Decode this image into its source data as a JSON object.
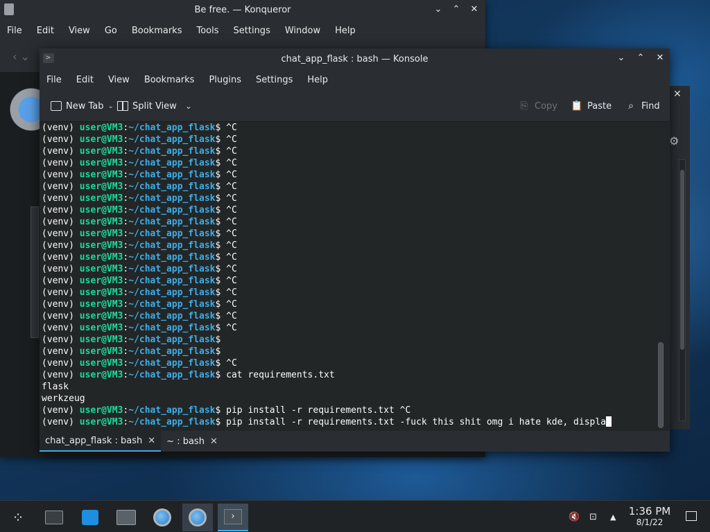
{
  "konqueror": {
    "title": "Be free. — Konqueror",
    "menu": [
      "File",
      "Edit",
      "View",
      "Go",
      "Bookmarks",
      "Tools",
      "Settings",
      "Window",
      "Help"
    ]
  },
  "konsole": {
    "title": "chat_app_flask : bash — Konsole",
    "menu": [
      "File",
      "Edit",
      "View",
      "Bookmarks",
      "Plugins",
      "Settings",
      "Help"
    ],
    "toolbar": {
      "new_tab": "New Tab",
      "split_view": "Split View",
      "copy": "Copy",
      "paste": "Paste",
      "find": "Find"
    },
    "prompt": {
      "venv": "(venv) ",
      "user": "user@VM3",
      "path": "~/chat_app_flask",
      "sym": "$ "
    },
    "lines": [
      {
        "type": "prompt",
        "cmd": "^C"
      },
      {
        "type": "prompt",
        "cmd": "^C"
      },
      {
        "type": "prompt",
        "cmd": "^C"
      },
      {
        "type": "prompt",
        "cmd": "^C"
      },
      {
        "type": "prompt",
        "cmd": "^C"
      },
      {
        "type": "prompt",
        "cmd": "^C"
      },
      {
        "type": "prompt",
        "cmd": "^C"
      },
      {
        "type": "prompt",
        "cmd": "^C"
      },
      {
        "type": "prompt",
        "cmd": "^C"
      },
      {
        "type": "prompt",
        "cmd": "^C"
      },
      {
        "type": "prompt",
        "cmd": "^C"
      },
      {
        "type": "prompt",
        "cmd": "^C"
      },
      {
        "type": "prompt",
        "cmd": "^C"
      },
      {
        "type": "prompt",
        "cmd": "^C"
      },
      {
        "type": "prompt",
        "cmd": "^C"
      },
      {
        "type": "prompt",
        "cmd": "^C"
      },
      {
        "type": "prompt",
        "cmd": "^C"
      },
      {
        "type": "prompt",
        "cmd": "^C"
      },
      {
        "type": "prompt",
        "cmd": ""
      },
      {
        "type": "prompt",
        "cmd": ""
      },
      {
        "type": "prompt",
        "cmd": "^C"
      },
      {
        "type": "prompt",
        "cmd": "cat requirements.txt"
      },
      {
        "type": "output",
        "text": "flask"
      },
      {
        "type": "output",
        "text": "werkzeug"
      },
      {
        "type": "prompt",
        "cmd": "pip install -r requirements.txt ^C"
      },
      {
        "type": "prompt",
        "cmd": "pip install -r requirements.txt -fuck this shit omg i hate kde, displa",
        "cursor": true
      }
    ],
    "tabs": [
      {
        "label": "chat_app_flask : bash",
        "active": true
      },
      {
        "label": "~ : bash",
        "active": false
      }
    ]
  },
  "taskbar": {
    "time": "1:36 PM",
    "date": "8/1/22"
  },
  "colors": {
    "accent": "#3daee9",
    "prompt_user": "#1cdc9a",
    "prompt_path": "#3daee9"
  }
}
